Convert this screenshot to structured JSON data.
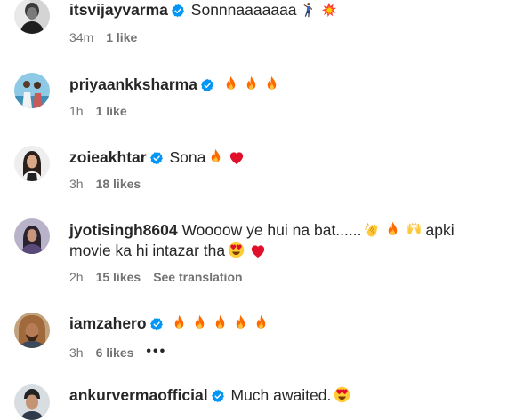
{
  "comments": [
    {
      "username": "itsvijayvarma",
      "verified": true,
      "text": "Sonnnaaaaaaa",
      "emojis": [
        "dancer-emoji",
        "collision-emoji"
      ],
      "time": "34m",
      "likes": "1 like"
    },
    {
      "username": "priyaankksharma",
      "verified": true,
      "text": "",
      "emojis": [
        "fire-emoji",
        "fire-emoji",
        "fire-emoji"
      ],
      "time": "1h",
      "likes": "1 like"
    },
    {
      "username": "zoieakhtar",
      "verified": true,
      "text": "Sona",
      "emojis": [
        "fire-emoji",
        "red-heart-emoji"
      ],
      "time": "3h",
      "likes": "18 likes"
    },
    {
      "username": "jyotisingh8604",
      "verified": false,
      "text_part1": "Woooow ye hui na bat......",
      "text_part2": "apki movie ka hi intazar tha",
      "emojis": [
        "clapping-hands-emoji",
        "fire-emoji",
        "raising-hands-emoji",
        "heart-eyes-emoji",
        "red-heart-emoji"
      ],
      "time": "2h",
      "likes": "15 likes",
      "translation": "See translation"
    },
    {
      "username": "iamzahero",
      "verified": true,
      "text": "",
      "emojis": [
        "fire-emoji",
        "fire-emoji",
        "fire-emoji",
        "fire-emoji",
        "fire-emoji"
      ],
      "time": "3h",
      "likes": "6 likes",
      "more": "•••"
    },
    {
      "username": "ankurvermaofficial",
      "verified": true,
      "text": "Much awaited.",
      "emojis": [
        "heart-eyes-emoji"
      ]
    }
  ],
  "colors": {
    "verified_badge": "#0095f6",
    "meta_text": "#737373",
    "primary_text": "#262626",
    "fire": "#ff6a00",
    "heart": "#e0102a"
  }
}
